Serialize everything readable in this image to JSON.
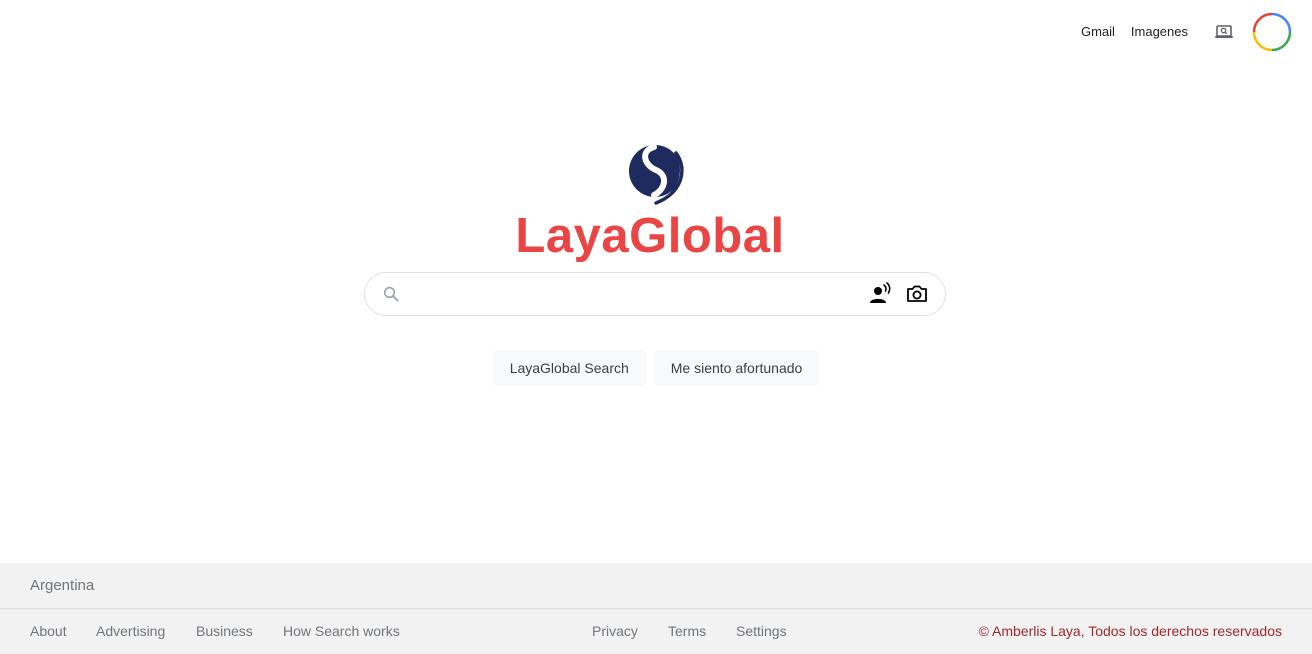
{
  "header": {
    "gmail_label": "Gmail",
    "images_label": "Imagenes",
    "apps_icon": "laptop-search-icon",
    "avatar_colors": [
      "#ea4335",
      "#fbbc05",
      "#34a853",
      "#4285f4"
    ]
  },
  "logo": {
    "mark_color": "#1f2a5e",
    "text": "LayaGlobal",
    "text_color": "#e94545"
  },
  "search": {
    "value": "",
    "placeholder": "",
    "search_icon": "search-icon",
    "voice_icon": "voice-search-icon",
    "camera_icon": "camera-icon"
  },
  "buttons": {
    "search_label": "LayaGlobal Search",
    "lucky_label": "Me siento afortunado"
  },
  "footer": {
    "country": "Argentina",
    "left_links": [
      "About",
      "Advertising",
      "Business",
      "How Search works"
    ],
    "center_links": [
      "Privacy",
      "Terms",
      "Settings"
    ],
    "copyright": "© Amberlis Laya, Todos los derechos reservados",
    "copyright_color": "#a52a2a"
  }
}
